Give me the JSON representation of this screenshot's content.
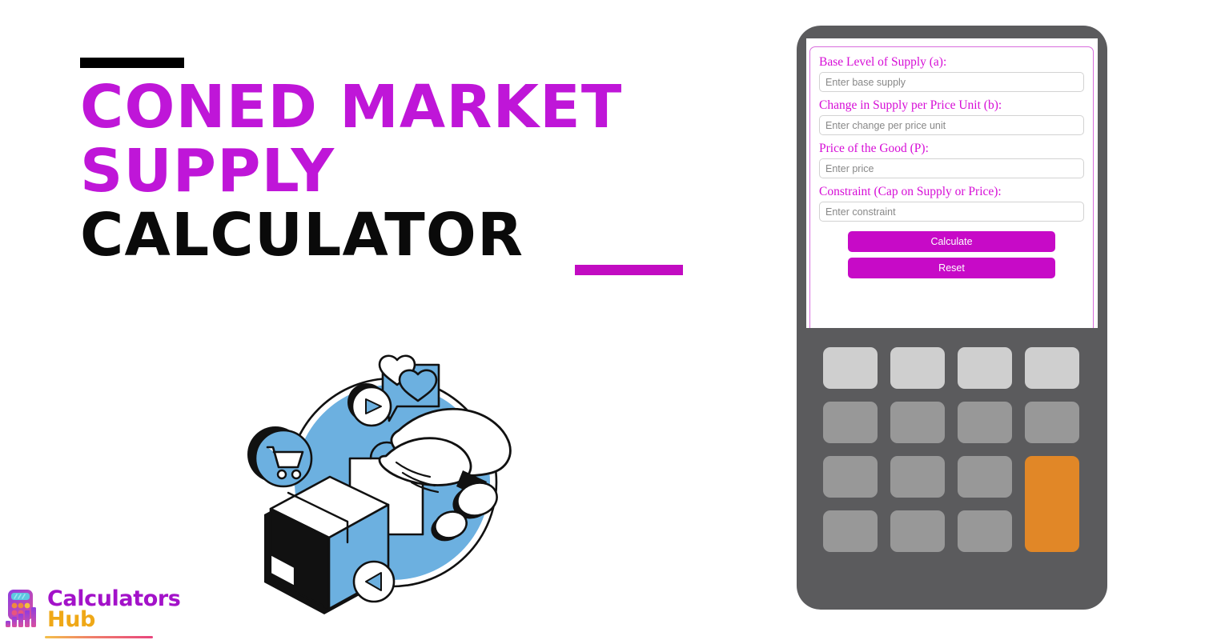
{
  "page": {
    "title_lines": [
      "Coned Market",
      "Supply",
      "Calculator"
    ],
    "colors": {
      "title_magenta": "#bf16d8",
      "title_dark": "#0a0a0a",
      "accent_bar_top": "#000000",
      "accent_bar_bottom": "#c20cc2",
      "device_body": "#5b5b5d",
      "button_magenta": "#c70ac7",
      "key_light": "#cfcfcf",
      "key_gray": "#989898",
      "key_orange": "#e18727",
      "label_magenta": "#d60dd6",
      "illustration_blue": "#6cb0e0"
    }
  },
  "logo": {
    "word_1": "Calculators",
    "word_2": "Hub",
    "mark_icon": "calculator-bar-chart-icon"
  },
  "illustration": {
    "name": "ecommerce-delivery-illustration",
    "elements": [
      "shopping-cart-icon",
      "heart-icon",
      "play-button-icon",
      "package-box",
      "hands",
      "shopping-bag"
    ]
  },
  "calculator": {
    "form": {
      "fields": [
        {
          "label": "Base Level of Supply (a):",
          "placeholder": "Enter base supply",
          "value": "",
          "name": "base-supply-input"
        },
        {
          "label": "Change in Supply per Price Unit (b):",
          "placeholder": "Enter change per price unit",
          "value": "",
          "name": "change-per-price-unit-input"
        },
        {
          "label": "Price of the Good (P):",
          "placeholder": "Enter price",
          "value": "",
          "name": "price-input"
        },
        {
          "label": "Constraint (Cap on Supply or Price):",
          "placeholder": "Enter constraint",
          "value": "",
          "name": "constraint-input"
        }
      ],
      "calculate_label": "Calculate",
      "reset_label": "Reset"
    },
    "keypad": {
      "rows": 4,
      "columns": 4,
      "keys": [
        {
          "style": "light"
        },
        {
          "style": "light"
        },
        {
          "style": "light"
        },
        {
          "style": "light"
        },
        {
          "style": "gray"
        },
        {
          "style": "gray"
        },
        {
          "style": "gray"
        },
        {
          "style": "gray"
        },
        {
          "style": "gray"
        },
        {
          "style": "gray"
        },
        {
          "style": "gray"
        },
        {
          "style": "orange"
        },
        {
          "style": "gray"
        },
        {
          "style": "gray"
        },
        {
          "style": "gray"
        }
      ]
    }
  }
}
